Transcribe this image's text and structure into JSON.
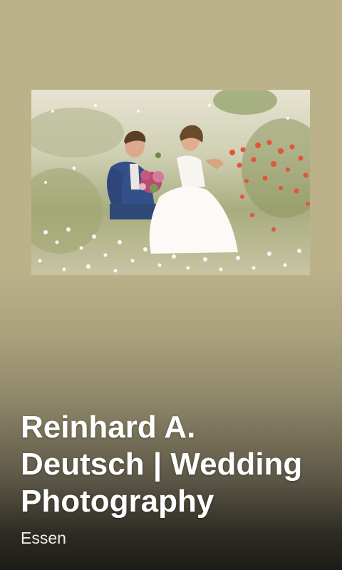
{
  "listing": {
    "title": "Reinhard A. Deutsch | Wedding Photography",
    "location": "Essen"
  }
}
